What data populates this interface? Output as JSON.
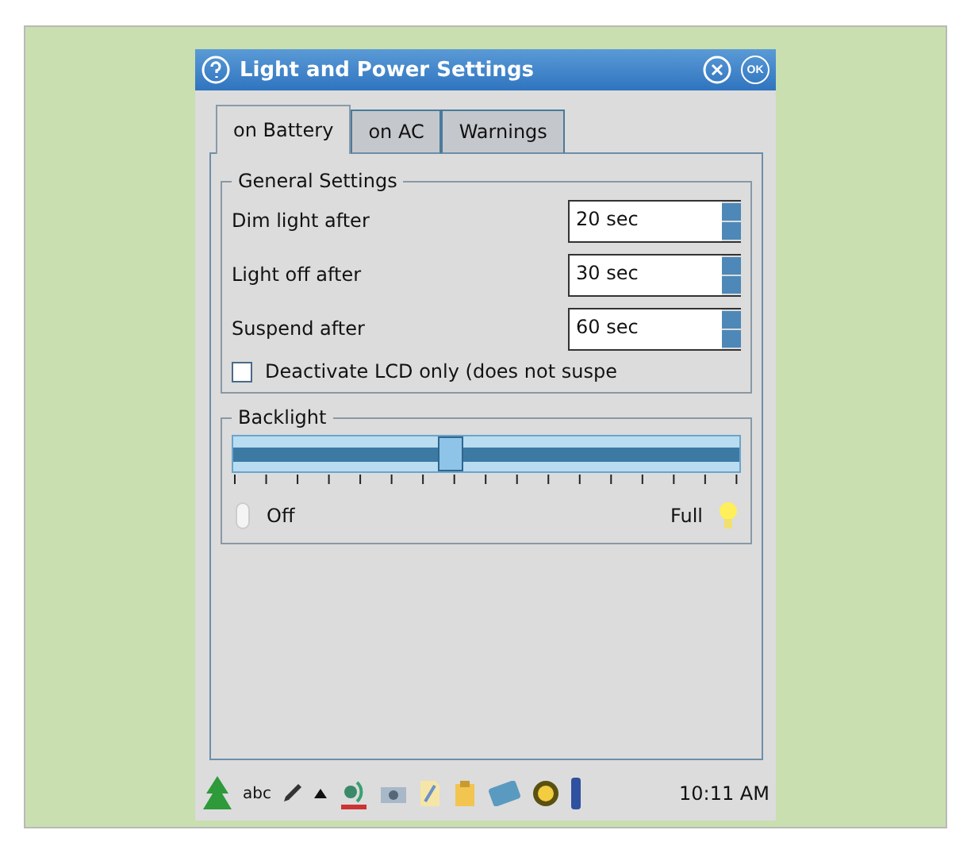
{
  "window": {
    "title": "Light and Power Settings",
    "ok_label": "OK"
  },
  "tabs": [
    {
      "label": "on Battery",
      "selected": true
    },
    {
      "label": "on AC",
      "selected": false
    },
    {
      "label": "Warnings",
      "selected": false
    }
  ],
  "general": {
    "title": "General Settings",
    "rows": [
      {
        "label": "Dim light after",
        "value": "20 sec"
      },
      {
        "label": "Light off after",
        "value": "30 sec"
      },
      {
        "label": "Suspend after",
        "value": "60 sec"
      }
    ],
    "checkbox": {
      "label": "Deactivate LCD only (does not suspe",
      "checked": false
    }
  },
  "backlight": {
    "title": "Backlight",
    "level": 0.43,
    "min_label": "Off",
    "max_label": "Full"
  },
  "taskbar": {
    "input_label": "abc",
    "clock": "10:11 AM"
  }
}
